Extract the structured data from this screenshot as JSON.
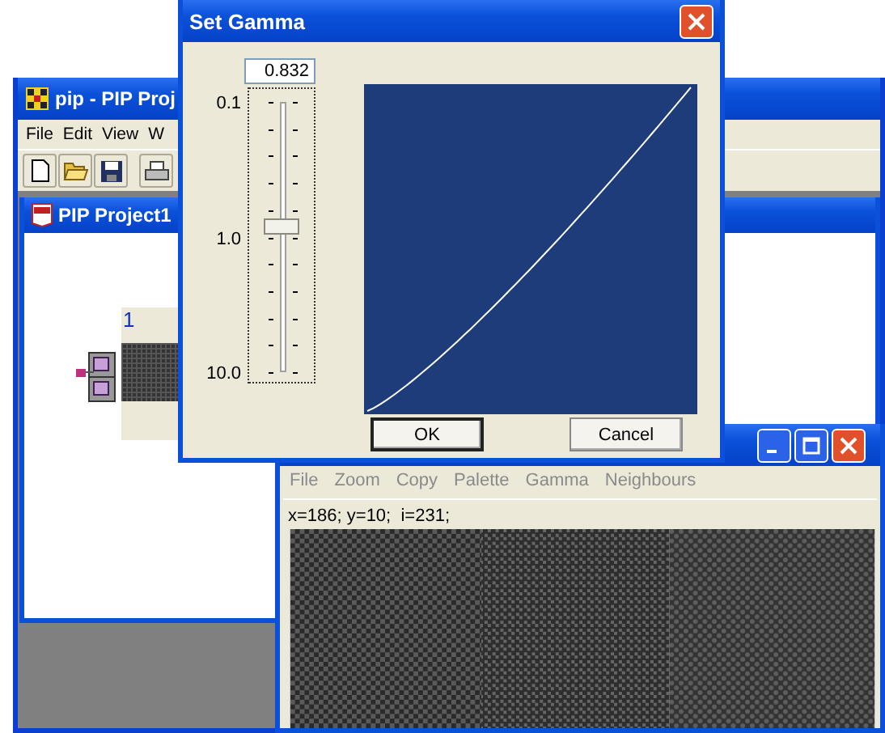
{
  "main_window": {
    "title": "pip - PIP Proj",
    "menu": [
      {
        "label": "File"
      },
      {
        "label": "Edit"
      },
      {
        "label": "View"
      },
      {
        "label": "W"
      }
    ],
    "child_window": {
      "title": "PIP Project1",
      "node_label": "1"
    }
  },
  "dialog": {
    "title": "Set Gamma",
    "value": "0.832",
    "slider": {
      "level": 0.54,
      "labels": [
        "0.1",
        "1.0",
        "10.0"
      ]
    },
    "buttons": [
      {
        "label": "OK",
        "default": true
      },
      {
        "label": "Cancel",
        "default": false
      }
    ]
  },
  "image_window": {
    "menu": [
      {
        "label": "File",
        "disabled": true
      },
      {
        "label": "Zoom",
        "disabled": true
      },
      {
        "label": "Copy",
        "disabled": true
      },
      {
        "label": "Palette",
        "disabled": true
      },
      {
        "label": "Gamma",
        "disabled": true
      },
      {
        "label": "Neighbours",
        "disabled": true
      }
    ],
    "status": "x=186; y=10;  i=231;"
  }
}
